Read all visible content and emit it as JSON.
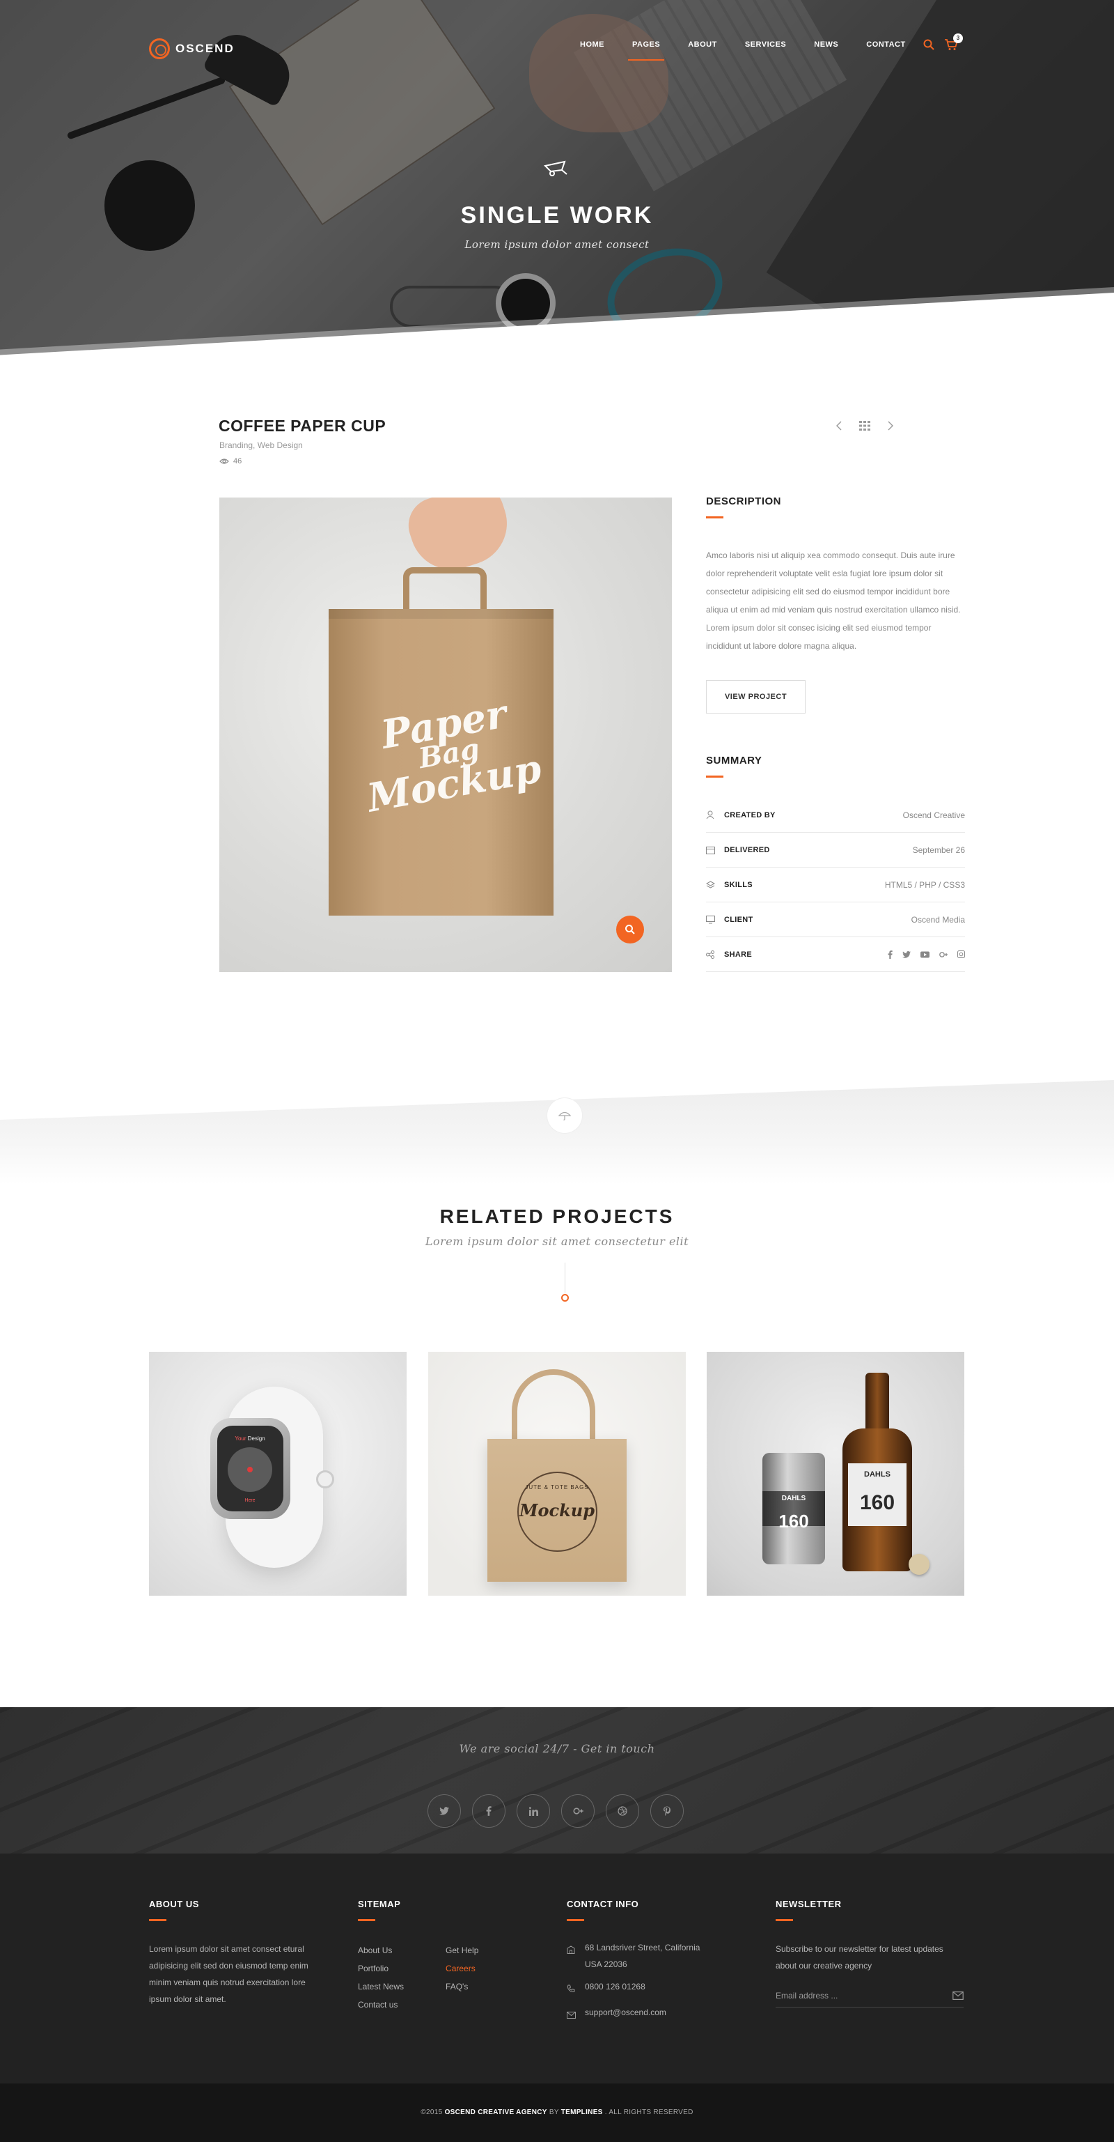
{
  "brand": {
    "name": "OSCEND",
    "accent": "#f26522"
  },
  "nav": {
    "items": [
      "HOME",
      "PAGES",
      "ABOUT",
      "SERVICES",
      "NEWS",
      "CONTACT"
    ],
    "active": "PAGES",
    "cart_count": "3"
  },
  "hero": {
    "icon": "wheelbarrow-icon",
    "title": "SINGLE WORK",
    "subtitle": "Lorem ipsum dolor amet consect"
  },
  "project": {
    "title": "COFFEE PAPER CUP",
    "categories": "Branding, Web Design",
    "views": "46",
    "image_script": [
      "Paper",
      "Bag",
      "Mockup"
    ]
  },
  "description": {
    "heading": "DESCRIPTION",
    "text": "Amco laboris nisi ut aliquip xea commodo consequt. Duis aute irure dolor reprehenderit voluptate velit esla fugiat lore ipsum dolor sit consectetur adipisicing elit sed do eiusmod tempor incididunt bore aliqua ut enim ad mid veniam quis nostrud exercitation ullamco nisid. Lorem ipsum dolor sit consec isicing elit sed eiusmod tempor incididunt ut labore dolore magna aliqua.",
    "button": "VIEW PROJECT"
  },
  "summary": {
    "heading": "SUMMARY",
    "rows": [
      {
        "label": "CREATED BY",
        "value": "Oscend Creative"
      },
      {
        "label": "DELIVERED",
        "value": "September 26"
      },
      {
        "label": "SKILLS",
        "value": "HTML5 / PHP / CSS3"
      },
      {
        "label": "CLIENT",
        "value": "Oscend Media"
      },
      {
        "label": "SHARE",
        "value": ""
      }
    ]
  },
  "related": {
    "title": "RELATED PROJECTS",
    "subtitle": "Lorem ipsum dolor sit amet consectetur elit",
    "watch_text_1a": "Your",
    "watch_text_1b": "Design",
    "watch_text_2": "Here",
    "tote_small": "JUTE & TOTE BAGS",
    "tote_mock": "Mockup",
    "beer_brand": "DAHLS",
    "beer_num": "160"
  },
  "social": {
    "tagline": "We are social 24/7 - Get in touch",
    "icons": [
      "twitter-icon",
      "facebook-icon",
      "linkedin-icon",
      "google-plus-icon",
      "dribbble-icon",
      "pinterest-icon"
    ]
  },
  "footer": {
    "about": {
      "title": "ABOUT US",
      "text": "Lorem ipsum dolor sit amet consect etural adipisicing elit sed don eiusmod temp enim minim veniam quis notrud exercitation lore ipsum dolor sit amet."
    },
    "sitemap": {
      "title": "SITEMAP",
      "col1": [
        "About Us",
        "Portfolio",
        "Latest News",
        "Contact us"
      ],
      "col2": [
        "Get Help",
        "Careers",
        "FAQ's"
      ]
    },
    "contact": {
      "title": "CONTACT INFO",
      "address_1": "68 Landsriver Street, California",
      "address_2": "USA 22036",
      "phone": "0800 126 01268",
      "email": "support@oscend.com"
    },
    "newsletter": {
      "title": "NEWSLETTER",
      "text": "Subscribe to our newsletter for latest updates about our creative agency",
      "placeholder": "Email address ..."
    },
    "copyright_pre": "©2015",
    "copyright_brand": "OSCEND CREATIVE AGENCY",
    "copyright_by": "BY",
    "copyright_author": "TEMPLINES",
    "copyright_post": ". ALL RIGHTS RESERVED"
  }
}
